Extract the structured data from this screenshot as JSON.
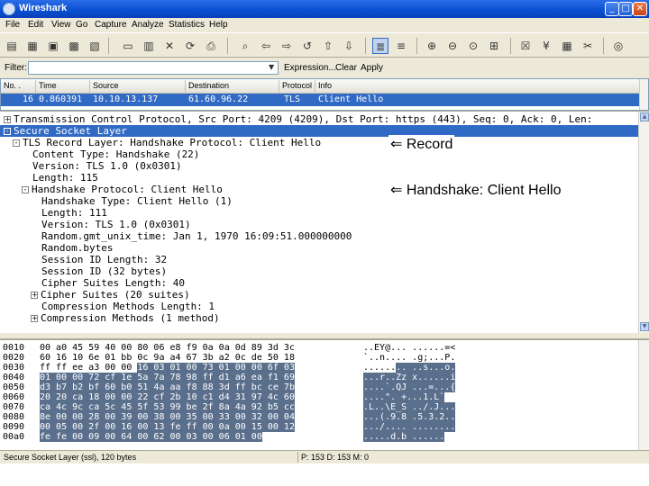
{
  "window": {
    "title": "Wireshark"
  },
  "menu": [
    "File",
    "Edit",
    "View",
    "Go",
    "Capture",
    "Analyze",
    "Statistics",
    "Help"
  ],
  "filter": {
    "label": "Filter:",
    "value": "",
    "expression_label": "Expression...",
    "clear_label": "Clear",
    "apply_label": "Apply"
  },
  "packet_list": {
    "columns": [
      "No. .",
      "Time",
      "Source",
      "Destination",
      "Protocol",
      "Info"
    ],
    "row": {
      "no": "16",
      "time": "0.860391",
      "source": "10.10.13.137",
      "destination": "61.60.96.22",
      "protocol": "TLS",
      "info": "Client Hello"
    }
  },
  "detail": {
    "lines": [
      {
        "text": "Transmission Control Protocol, Src Port: 4209 (4209), Dst Port: https (443), Seq: 0, Ack: 0, Len:",
        "expander": "+"
      },
      {
        "text": "Secure Socket Layer",
        "expander": "-"
      },
      {
        "text": "TLS Record Layer: Handshake Protocol: Client Hello",
        "expander": "-"
      },
      {
        "text": "Content Type: Handshake (22)",
        "expander": ""
      },
      {
        "text": "Version: TLS 1.0 (0x0301)",
        "expander": ""
      },
      {
        "text": "Length: 115",
        "expander": ""
      },
      {
        "text": "Handshake Protocol: Client Hello",
        "expander": "-"
      },
      {
        "text": "Handshake Type: Client Hello (1)",
        "expander": ""
      },
      {
        "text": "Length: 111",
        "expander": ""
      },
      {
        "text": "Version: TLS 1.0 (0x0301)",
        "expander": ""
      },
      {
        "text": "Random.gmt_unix_time: Jan  1, 1970 16:09:51.000000000",
        "expander": ""
      },
      {
        "text": "Random.bytes",
        "expander": ""
      },
      {
        "text": "Session ID Length: 32",
        "expander": ""
      },
      {
        "text": "Session ID (32 bytes)",
        "expander": ""
      },
      {
        "text": "Cipher Suites Length: 40",
        "expander": ""
      },
      {
        "text": "Cipher Suites (20 suites)",
        "expander": "+"
      },
      {
        "text": "Compression Methods Length: 1",
        "expander": ""
      },
      {
        "text": "Compression Methods (1 method)",
        "expander": "+"
      }
    ]
  },
  "annotations": {
    "record": "⇐ Record",
    "handshake": "⇐ Handshake: Client Hello"
  },
  "hex": {
    "lines": [
      {
        "offset": "0010",
        "pre": "00 a0 45 59 40 00 80 06  e8 f9 0a 0a 0d 89 3d 3c",
        "sel": "",
        "asc_pre": "..EY@... ......=<",
        "asc_sel": ""
      },
      {
        "offset": "0020",
        "pre": "60 16 10 6e 01 bb 0c 9a  a4 67 3b a2 0c de 50 18",
        "sel": "",
        "asc_pre": "`..n.... .g;...P.",
        "asc_sel": ""
      },
      {
        "offset": "0030",
        "pre": "ff ff ee a3 00 00 ",
        "sel": "16 03  01 00 73 01 00 00 6f 03",
        "asc_pre": "......",
        "asc_sel": ".. ..s...o."
      },
      {
        "offset": "0040",
        "pre": "",
        "sel": "01 00 00 72 cf 1e 5a 7a  78 98 ff d1 a6 ea f1 69",
        "asc_pre": "",
        "asc_sel": "...r..Zz x......i"
      },
      {
        "offset": "0050",
        "pre": "",
        "sel": "d3 b7 b2 bf 60 b0 51 4a  aa f8 88 3d ff bc ce 7b",
        "asc_pre": "",
        "asc_sel": "....`.QJ ...=...{"
      },
      {
        "offset": "0060",
        "pre": "",
        "sel": "20 20 ca 18 00 00 22 cf  2b 10 c1 d4 31 97 4c 60",
        "asc_pre": "",
        "asc_sel": "  ....\". +...1.L`"
      },
      {
        "offset": "0070",
        "pre": "",
        "sel": "ca 4c 9c ca 5c 45 5f 53  99 be 2f 8a 4a 92 b5 cc",
        "asc_pre": "",
        "asc_sel": ".L..\\E_S ../.J..."
      },
      {
        "offset": "0080",
        "pre": "",
        "sel": "8e 00 00 28 00 39 00 38  00 35 00 33 00 32 00 04",
        "asc_pre": "",
        "asc_sel": "...(.9.8 .5.3.2.."
      },
      {
        "offset": "0090",
        "pre": "",
        "sel": "00 05 00 2f 00 16 00 13  fe ff 00 0a 00 15 00 12",
        "asc_pre": "",
        "asc_sel": ".../.... ........"
      },
      {
        "offset": "00a0",
        "pre": "",
        "sel": "fe fe 00 09 00 64 00 62  00 03 00 06 01 00",
        "asc_pre": "",
        "asc_sel": ".....d.b ......"
      }
    ]
  },
  "status": {
    "left": "Secure Socket Layer (ssl), 120 bytes",
    "right": "P: 153 D: 153 M: 0"
  },
  "colors": {
    "selection": "#316ac5",
    "hex_highlight": "#5a6f8c"
  }
}
